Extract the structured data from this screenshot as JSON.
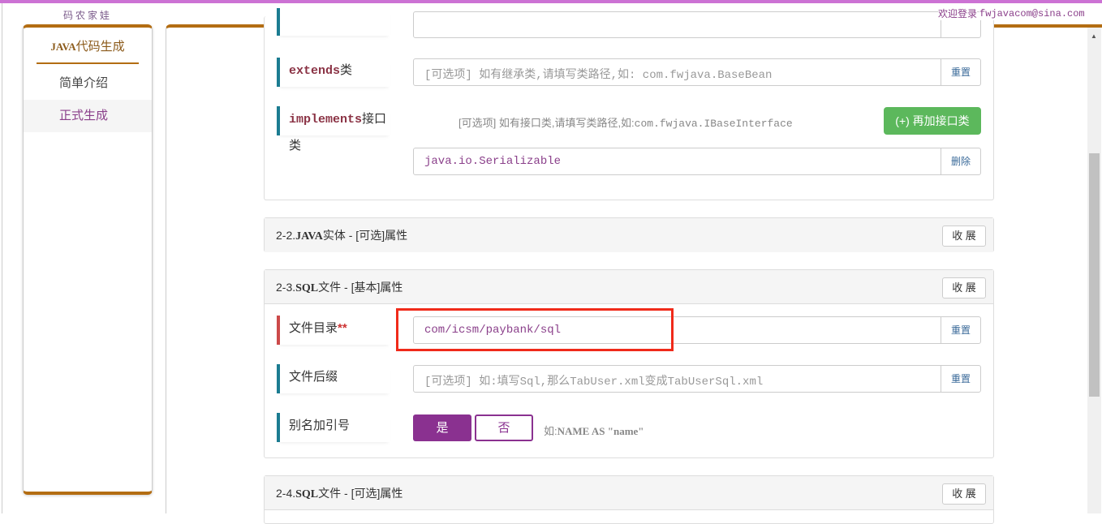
{
  "header": {
    "brand": "码农家娃",
    "welcome": "欢迎登录",
    "user": "fwjavacom@sina.com"
  },
  "sidebar": {
    "title_code": "JAVA",
    "title_rest": "代码生成",
    "items": [
      {
        "label": "简单介绍"
      },
      {
        "label": "正式生成"
      }
    ]
  },
  "panel1": {
    "extends": {
      "label_code": "extends",
      "label_rest": "类",
      "placeholder": "[可选项]  如有继承类,请填写类路径,如: com.fwjava.BaseBean",
      "button": "重置"
    },
    "implements": {
      "label_code": "implements",
      "label_rest": "接口类",
      "hint": "[可选项] 如有接口类,请填写类路径,如:",
      "hint_code": "com.fwjava.IBaseInterface",
      "add_button": "(+) 再加接口类",
      "value": "java.io.Serializable",
      "delete_button": "删除"
    }
  },
  "panel2": {
    "prefix": "2-2.",
    "code": "JAVA",
    "title": "实体 - [可选]属性",
    "toggle": "收 展"
  },
  "panel3": {
    "prefix": "2-3.",
    "code": "SQL",
    "title": "文件 - [基本]属性",
    "toggle": "收 展",
    "dir": {
      "label": "文件目录",
      "required": "**",
      "value": "com/icsm/paybank/sql",
      "button": "重置"
    },
    "suffix": {
      "label": "文件后缀",
      "placeholder": "[可选项]  如:填写Sql,那么TabUser.xml变成TabUserSql.xml",
      "button": "重置"
    },
    "alias": {
      "label": "别名加引号",
      "yes": "是",
      "no": "否",
      "hint": "如:",
      "hint_code": "NAME AS \"name\""
    }
  },
  "panel4": {
    "prefix": "2-4.",
    "code": "SQL",
    "title": "文件 - [可选]属性",
    "toggle": "收 展"
  },
  "colors": {
    "accent": "#b36d12",
    "purple": "#8a3190",
    "green": "#5cb85c",
    "highlight": "#f02a1a"
  }
}
